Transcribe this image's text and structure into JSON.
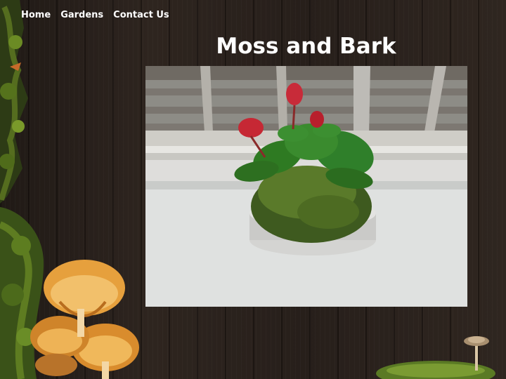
{
  "nav": {
    "home": "Home",
    "gardens": "Gardens",
    "contact": "Contact Us"
  },
  "site": {
    "title": "Moss and Bark"
  },
  "colors": {
    "background": "#231b16",
    "text": "#ffffff",
    "moss": "#3f5a1d",
    "mushroom": "#e09a35"
  },
  "images": {
    "hero": "Potted plant with red flowers on moss, sitting on a windowsill",
    "left_decoration": "moss-and-mushrooms-illustration",
    "right_decoration": "small-mushroom-on-moss-illustration"
  }
}
